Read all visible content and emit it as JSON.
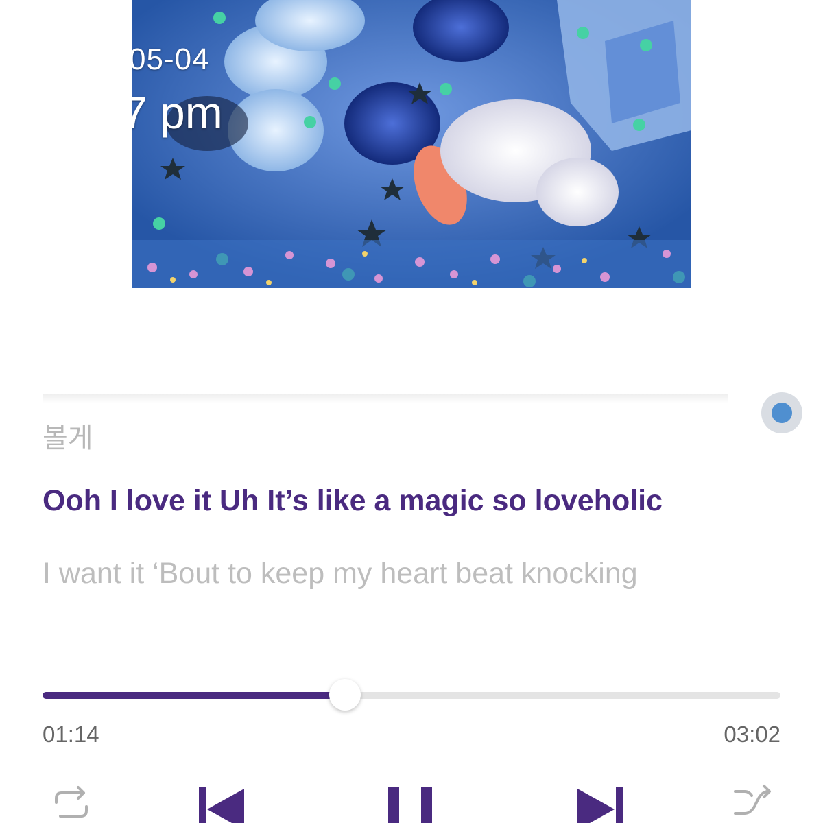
{
  "artwork": {
    "date_text": "05-04",
    "time_text": "7 pm"
  },
  "lyrics": {
    "previous": "볼게",
    "current": "Ooh I love it Uh It’s like a magic so loveholic",
    "next": "I want it ‘Bout to keep my heart beat knocking"
  },
  "playback": {
    "elapsed": "01:14",
    "total": "03:02",
    "progress_fraction": 0.41
  },
  "controls": {
    "repeat_icon": "repeat-icon",
    "previous_icon": "skip-previous-icon",
    "play_pause_icon": "pause-icon",
    "next_icon": "skip-next-icon",
    "shuffle_icon": "shuffle-icon"
  },
  "colors": {
    "accent": "#4a2a80",
    "track": "#e4e4e4",
    "sync_dot": "#4f8fd0"
  }
}
